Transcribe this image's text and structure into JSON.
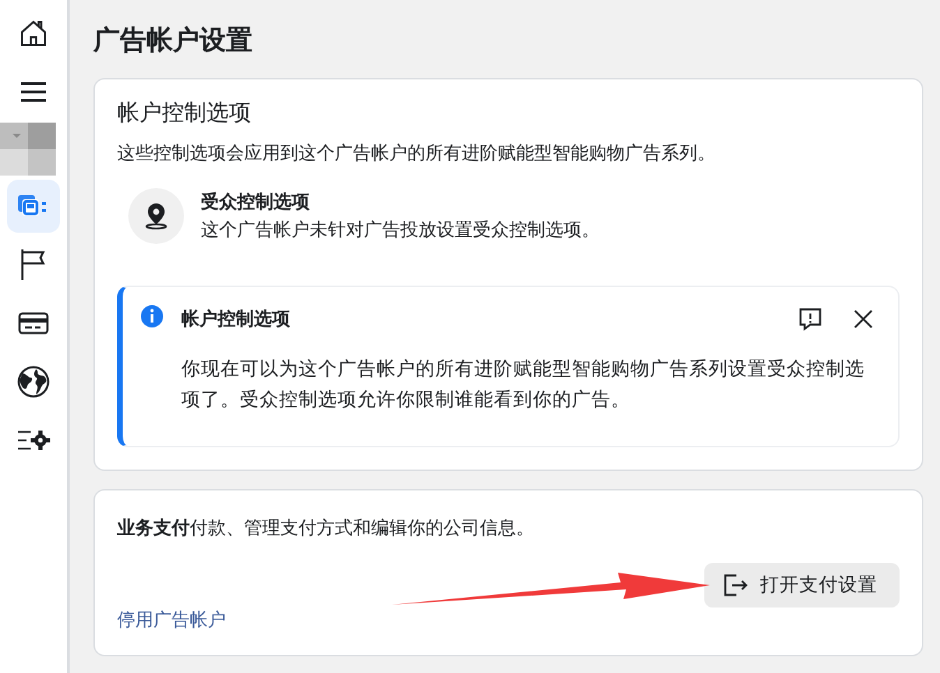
{
  "sidebar": {
    "items": [
      {
        "kind": "home",
        "selected": false
      },
      {
        "kind": "menu",
        "selected": false
      },
      {
        "kind": "account",
        "selected": false
      },
      {
        "kind": "campaigns",
        "selected": true
      },
      {
        "kind": "flag",
        "selected": false
      },
      {
        "kind": "card",
        "selected": false
      },
      {
        "kind": "globe",
        "selected": false
      },
      {
        "kind": "settings",
        "selected": false
      }
    ]
  },
  "page_title": "广告帐户设置",
  "controls_card": {
    "title": "帐户控制选项",
    "description": "这些控制选项会应用到这个广告帐户的所有进阶赋能型智能购物广告系列。",
    "option": {
      "title": "受众控制选项",
      "text": "这个广告帐户未针对广告投放设置受众控制选项。"
    },
    "notice": {
      "title": "帐户控制选项",
      "text": "你现在可以为这个广告帐户的所有进阶赋能型智能购物广告系列设置受众控制选项了。受众控制选项允许你限制谁能看到你的广告。"
    }
  },
  "payment_card": {
    "text": "**业务支付**付款、管理支付方式和编辑你的公司信息。",
    "button": "打开支付设置",
    "link": "停用广告帐户"
  }
}
